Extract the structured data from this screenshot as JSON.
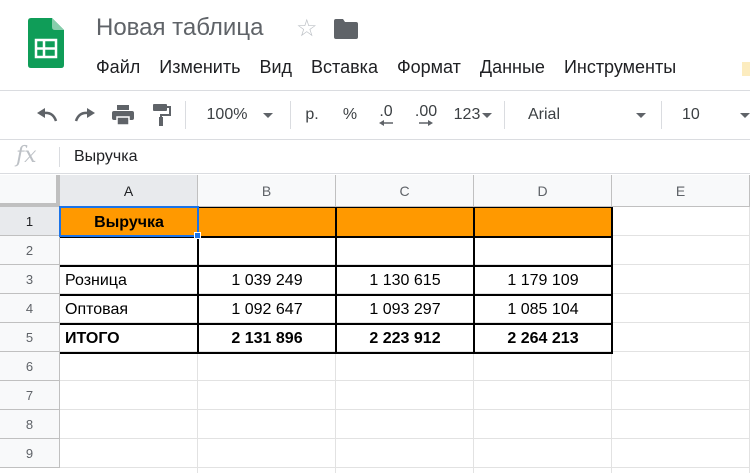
{
  "header": {
    "title": "Новая таблица",
    "menu": [
      "Файл",
      "Изменить",
      "Вид",
      "Вставка",
      "Формат",
      "Данные",
      "Инструменты"
    ]
  },
  "toolbar": {
    "zoom": "100%",
    "currency": "р.",
    "percent": "%",
    "decrease_decimals": ".0",
    "increase_decimals": ".00",
    "more_formats": "123",
    "font": "Arial",
    "font_size": "10"
  },
  "formula_bar": {
    "fx": "fx",
    "value": "Выручка"
  },
  "grid": {
    "columns": [
      "A",
      "B",
      "C",
      "D",
      "E"
    ],
    "rows": [
      "1",
      "2",
      "3",
      "4",
      "5",
      "6",
      "7",
      "8",
      "9"
    ],
    "cells": {
      "a1": "Выручка",
      "a3": "Розница",
      "b3": "1 039 249",
      "c3": "1 130 615",
      "d3": "1 179 109",
      "a4": "Оптовая",
      "b4": "1 092 647",
      "c4": "1 093 297",
      "d4": "1 085 104",
      "a5": "ИТОГО",
      "b5": "2 131 896",
      "c5": "2 223 912",
      "d5": "2 264 213"
    }
  },
  "colors": {
    "header_fill": "#ff9900",
    "selection": "#1a73e8",
    "logo_green": "#0f9d58"
  }
}
